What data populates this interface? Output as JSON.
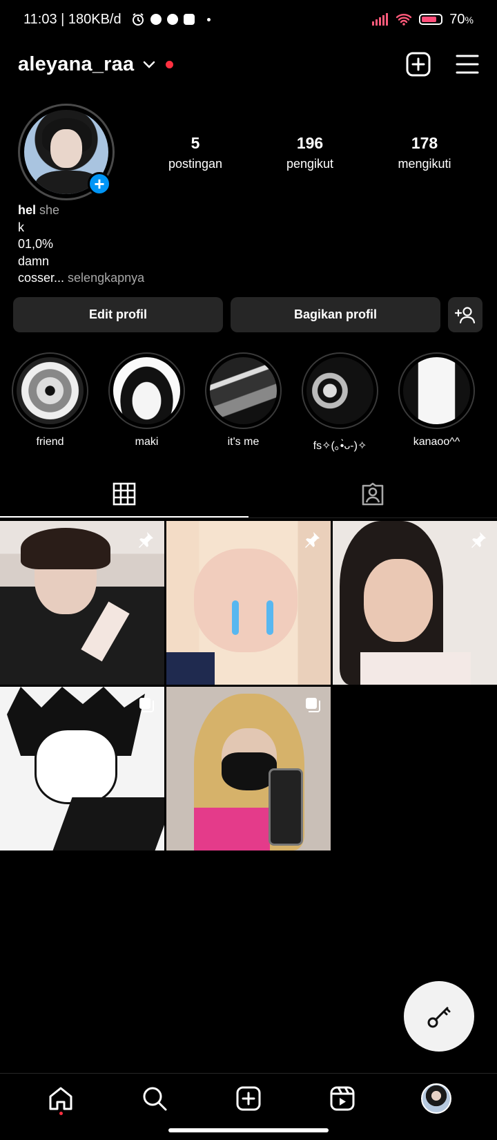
{
  "status_bar": {
    "time_speed": "11:03 | 180KB/d",
    "battery": "70",
    "battery_unit": "%",
    "battery_level": 0.7
  },
  "header": {
    "username": "aleyana_raa",
    "notification_dot_color": "#ff3040"
  },
  "profile": {
    "stats": [
      {
        "value": "5",
        "label": "postingan"
      },
      {
        "value": "196",
        "label": "pengikut"
      },
      {
        "value": "178",
        "label": "mengikuti"
      }
    ],
    "bio": {
      "name": "hel",
      "pronoun": "she",
      "lines": [
        "k",
        "01,0%",
        "damn"
      ],
      "last_line": "cosser...",
      "more": "selengkapnya"
    }
  },
  "buttons": {
    "edit": "Edit profil",
    "share": "Bagikan profil"
  },
  "highlights": [
    {
      "label": "friend"
    },
    {
      "label": "maki"
    },
    {
      "label": "it's me"
    },
    {
      "label": "fs✧(｡•̀ᴗ-)✧"
    },
    {
      "label": "kanaoo^^"
    }
  ],
  "colors": {
    "accent_blue": "#0095f6",
    "button_bg": "#262626",
    "muted_text": "#a8a8a8"
  },
  "icons": {
    "add_post": "plus-square-icon",
    "menu": "hamburger-menu-icon",
    "discover_people": "add-person-icon",
    "grid_tab": "grid-icon",
    "tagged_tab": "tagged-person-icon",
    "fab": "key-icon"
  }
}
